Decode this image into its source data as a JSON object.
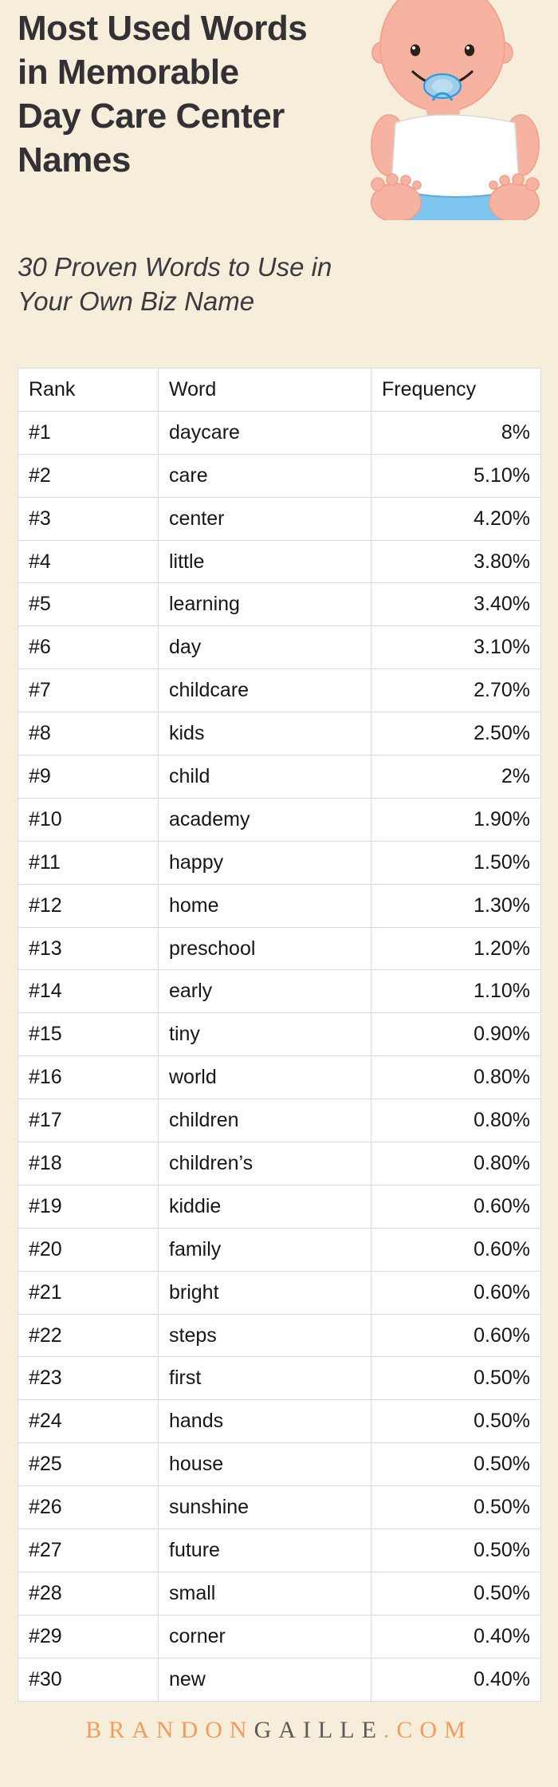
{
  "header": {
    "title": "Most Used Words in Memorable Day Care Center Names",
    "title_lines": "Most Used Words\nin Memorable\nDay Care Center\nNames",
    "subtitle": "30 Proven Words to Use in Your Own Biz Name",
    "subtitle_lines": "30 Proven Words to Use in\nYour Own Biz Name",
    "illustration": "baby-illustration"
  },
  "colors": {
    "background": "#f6eeda",
    "title_text": "#333136",
    "table_background": "#ffffff",
    "table_border": "#dcdcdc",
    "brand_orange": "#f59b5c",
    "brand_dark": "#5d5a57",
    "baby_skin": "#f7b3a1",
    "baby_diaper": "#7ec6ef",
    "baby_shirt": "#ffffff",
    "baby_pacifier": "#2f9bdd"
  },
  "table": {
    "columns": [
      "Rank",
      "Word",
      "Frequency"
    ],
    "rows": [
      {
        "rank": "#1",
        "word": "daycare",
        "frequency": "8%"
      },
      {
        "rank": "#2",
        "word": "care",
        "frequency": "5.10%"
      },
      {
        "rank": "#3",
        "word": "center",
        "frequency": "4.20%"
      },
      {
        "rank": "#4",
        "word": "little",
        "frequency": "3.80%"
      },
      {
        "rank": "#5",
        "word": "learning",
        "frequency": "3.40%"
      },
      {
        "rank": "#6",
        "word": "day",
        "frequency": "3.10%"
      },
      {
        "rank": "#7",
        "word": "childcare",
        "frequency": "2.70%"
      },
      {
        "rank": "#8",
        "word": "kids",
        "frequency": "2.50%"
      },
      {
        "rank": "#9",
        "word": "child",
        "frequency": "2%"
      },
      {
        "rank": "#10",
        "word": "academy",
        "frequency": "1.90%"
      },
      {
        "rank": "#11",
        "word": "happy",
        "frequency": "1.50%"
      },
      {
        "rank": "#12",
        "word": "home",
        "frequency": "1.30%"
      },
      {
        "rank": "#13",
        "word": "preschool",
        "frequency": "1.20%"
      },
      {
        "rank": "#14",
        "word": "early",
        "frequency": "1.10%"
      },
      {
        "rank": "#15",
        "word": "tiny",
        "frequency": "0.90%"
      },
      {
        "rank": "#16",
        "word": "world",
        "frequency": "0.80%"
      },
      {
        "rank": "#17",
        "word": "children",
        "frequency": "0.80%"
      },
      {
        "rank": "#18",
        "word": "children’s",
        "frequency": "0.80%"
      },
      {
        "rank": "#19",
        "word": "kiddie",
        "frequency": "0.60%"
      },
      {
        "rank": "#20",
        "word": "family",
        "frequency": "0.60%"
      },
      {
        "rank": "#21",
        "word": "bright",
        "frequency": "0.60%"
      },
      {
        "rank": "#22",
        "word": "steps",
        "frequency": "0.60%"
      },
      {
        "rank": "#23",
        "word": "first",
        "frequency": "0.50%"
      },
      {
        "rank": "#24",
        "word": "hands",
        "frequency": "0.50%"
      },
      {
        "rank": "#25",
        "word": "house",
        "frequency": "0.50%"
      },
      {
        "rank": "#26",
        "word": "sunshine",
        "frequency": "0.50%"
      },
      {
        "rank": "#27",
        "word": "future",
        "frequency": "0.50%"
      },
      {
        "rank": "#28",
        "word": "small",
        "frequency": "0.50%"
      },
      {
        "rank": "#29",
        "word": "corner",
        "frequency": "0.40%"
      },
      {
        "rank": "#30",
        "word": "new",
        "frequency": "0.40%"
      }
    ]
  },
  "chart_data": {
    "type": "table",
    "title": "Most Used Words in Memorable Day Care Center Names",
    "subtitle": "30 Proven Words to Use in Your Own Biz Name",
    "xlabel": "Word",
    "ylabel": "Frequency",
    "columns": [
      "Rank",
      "Word",
      "Frequency"
    ],
    "categories": [
      "daycare",
      "care",
      "center",
      "little",
      "learning",
      "day",
      "childcare",
      "kids",
      "child",
      "academy",
      "happy",
      "home",
      "preschool",
      "early",
      "tiny",
      "world",
      "children",
      "children’s",
      "kiddie",
      "family",
      "bright",
      "steps",
      "first",
      "hands",
      "house",
      "sunshine",
      "future",
      "small",
      "corner",
      "new"
    ],
    "values": [
      8,
      5.1,
      4.2,
      3.8,
      3.4,
      3.1,
      2.7,
      2.5,
      2,
      1.9,
      1.5,
      1.3,
      1.2,
      1.1,
      0.9,
      0.8,
      0.8,
      0.8,
      0.6,
      0.6,
      0.6,
      0.6,
      0.5,
      0.5,
      0.5,
      0.5,
      0.5,
      0.5,
      0.4,
      0.4
    ],
    "value_labels": [
      "8%",
      "5.10%",
      "4.20%",
      "3.80%",
      "3.40%",
      "3.10%",
      "2.70%",
      "2.50%",
      "2%",
      "1.90%",
      "1.50%",
      "1.30%",
      "1.20%",
      "1.10%",
      "0.90%",
      "0.80%",
      "0.80%",
      "0.80%",
      "0.60%",
      "0.60%",
      "0.60%",
      "0.60%",
      "0.50%",
      "0.50%",
      "0.50%",
      "0.50%",
      "0.50%",
      "0.50%",
      "0.40%",
      "0.40%"
    ],
    "ranks": [
      "#1",
      "#2",
      "#3",
      "#4",
      "#5",
      "#6",
      "#7",
      "#8",
      "#9",
      "#10",
      "#11",
      "#12",
      "#13",
      "#14",
      "#15",
      "#16",
      "#17",
      "#18",
      "#19",
      "#20",
      "#21",
      "#22",
      "#23",
      "#24",
      "#25",
      "#26",
      "#27",
      "#28",
      "#29",
      "#30"
    ],
    "units": "percent",
    "grid": true,
    "legend": "none"
  },
  "footer": {
    "brand_part1": "BRANDON",
    "brand_part2": "GAILLE",
    "brand_part3": ".COM",
    "brand_full": "BRANDONGAILLE.COM"
  }
}
